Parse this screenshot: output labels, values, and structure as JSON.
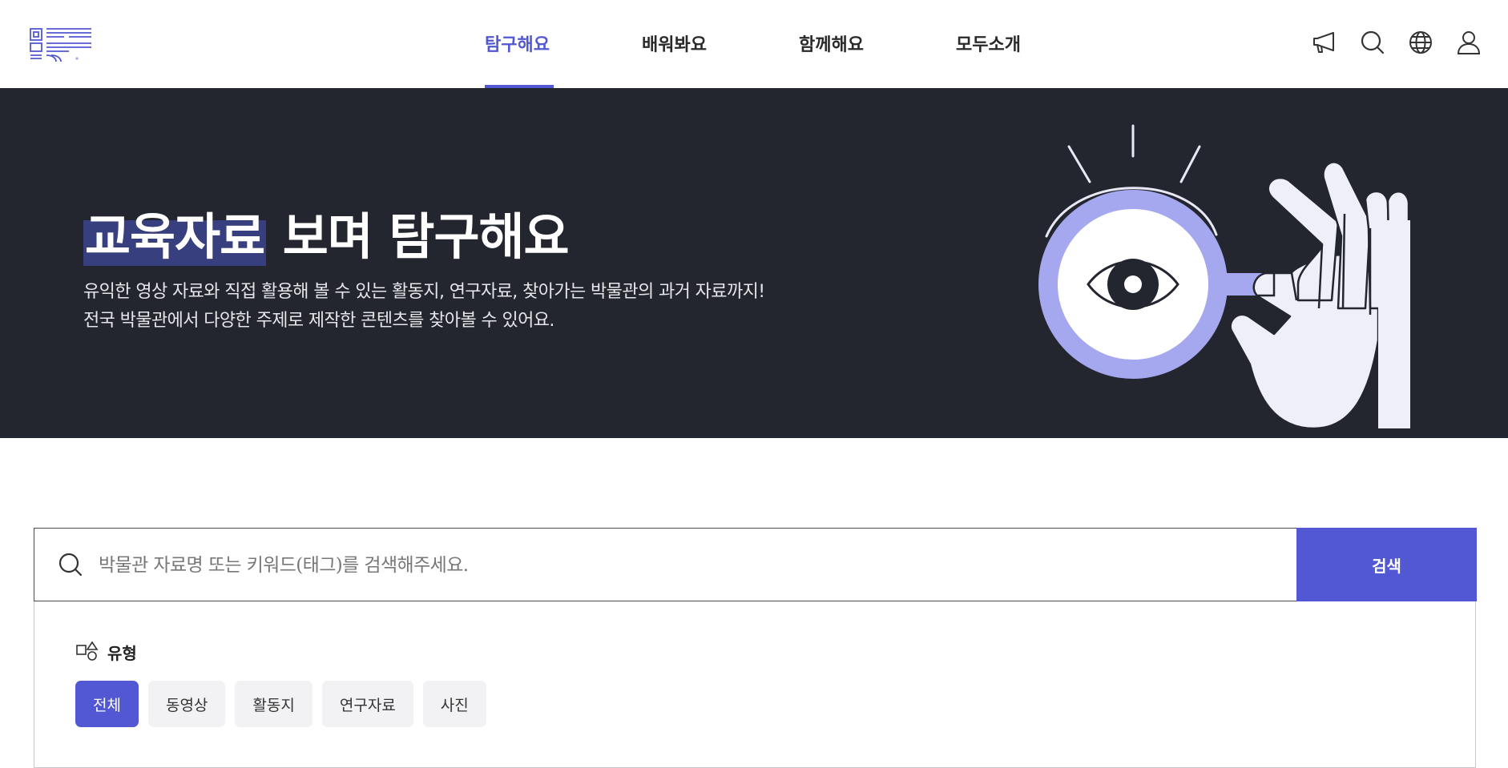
{
  "header": {
    "nav": [
      {
        "label": "탐구해요",
        "active": true
      },
      {
        "label": "배워봐요",
        "active": false
      },
      {
        "label": "함께해요",
        "active": false
      },
      {
        "label": "모두소개",
        "active": false
      }
    ],
    "icons": [
      "megaphone-icon",
      "search-icon",
      "globe-icon",
      "user-icon"
    ]
  },
  "hero": {
    "title_highlight": "교육자료",
    "title_rest": " 보며 탐구해요",
    "desc_line1": "유익한 영상 자료와 직접 활용해 볼 수 있는 활동지, 연구자료, 찾아가는 박물관의 과거 자료까지!",
    "desc_line2": "전국 박물관에서 다양한 주제로 제작한 콘텐츠를 찾아볼 수 있어요."
  },
  "search": {
    "placeholder": "박물관 자료명 또는 키워드(태그)를 검색해주세요.",
    "value": "",
    "button_label": "검색"
  },
  "filter": {
    "label": "유형",
    "chips": [
      {
        "label": "전체",
        "active": true
      },
      {
        "label": "동영상",
        "active": false
      },
      {
        "label": "활동지",
        "active": false
      },
      {
        "label": "연구자료",
        "active": false
      },
      {
        "label": "사진",
        "active": false
      }
    ]
  },
  "colors": {
    "accent": "#5257d4",
    "hero_bg": "#23262f",
    "title_highlight_bg": "#383f7e",
    "lens": "#a5a8ee",
    "hand": "#eeeff8"
  }
}
